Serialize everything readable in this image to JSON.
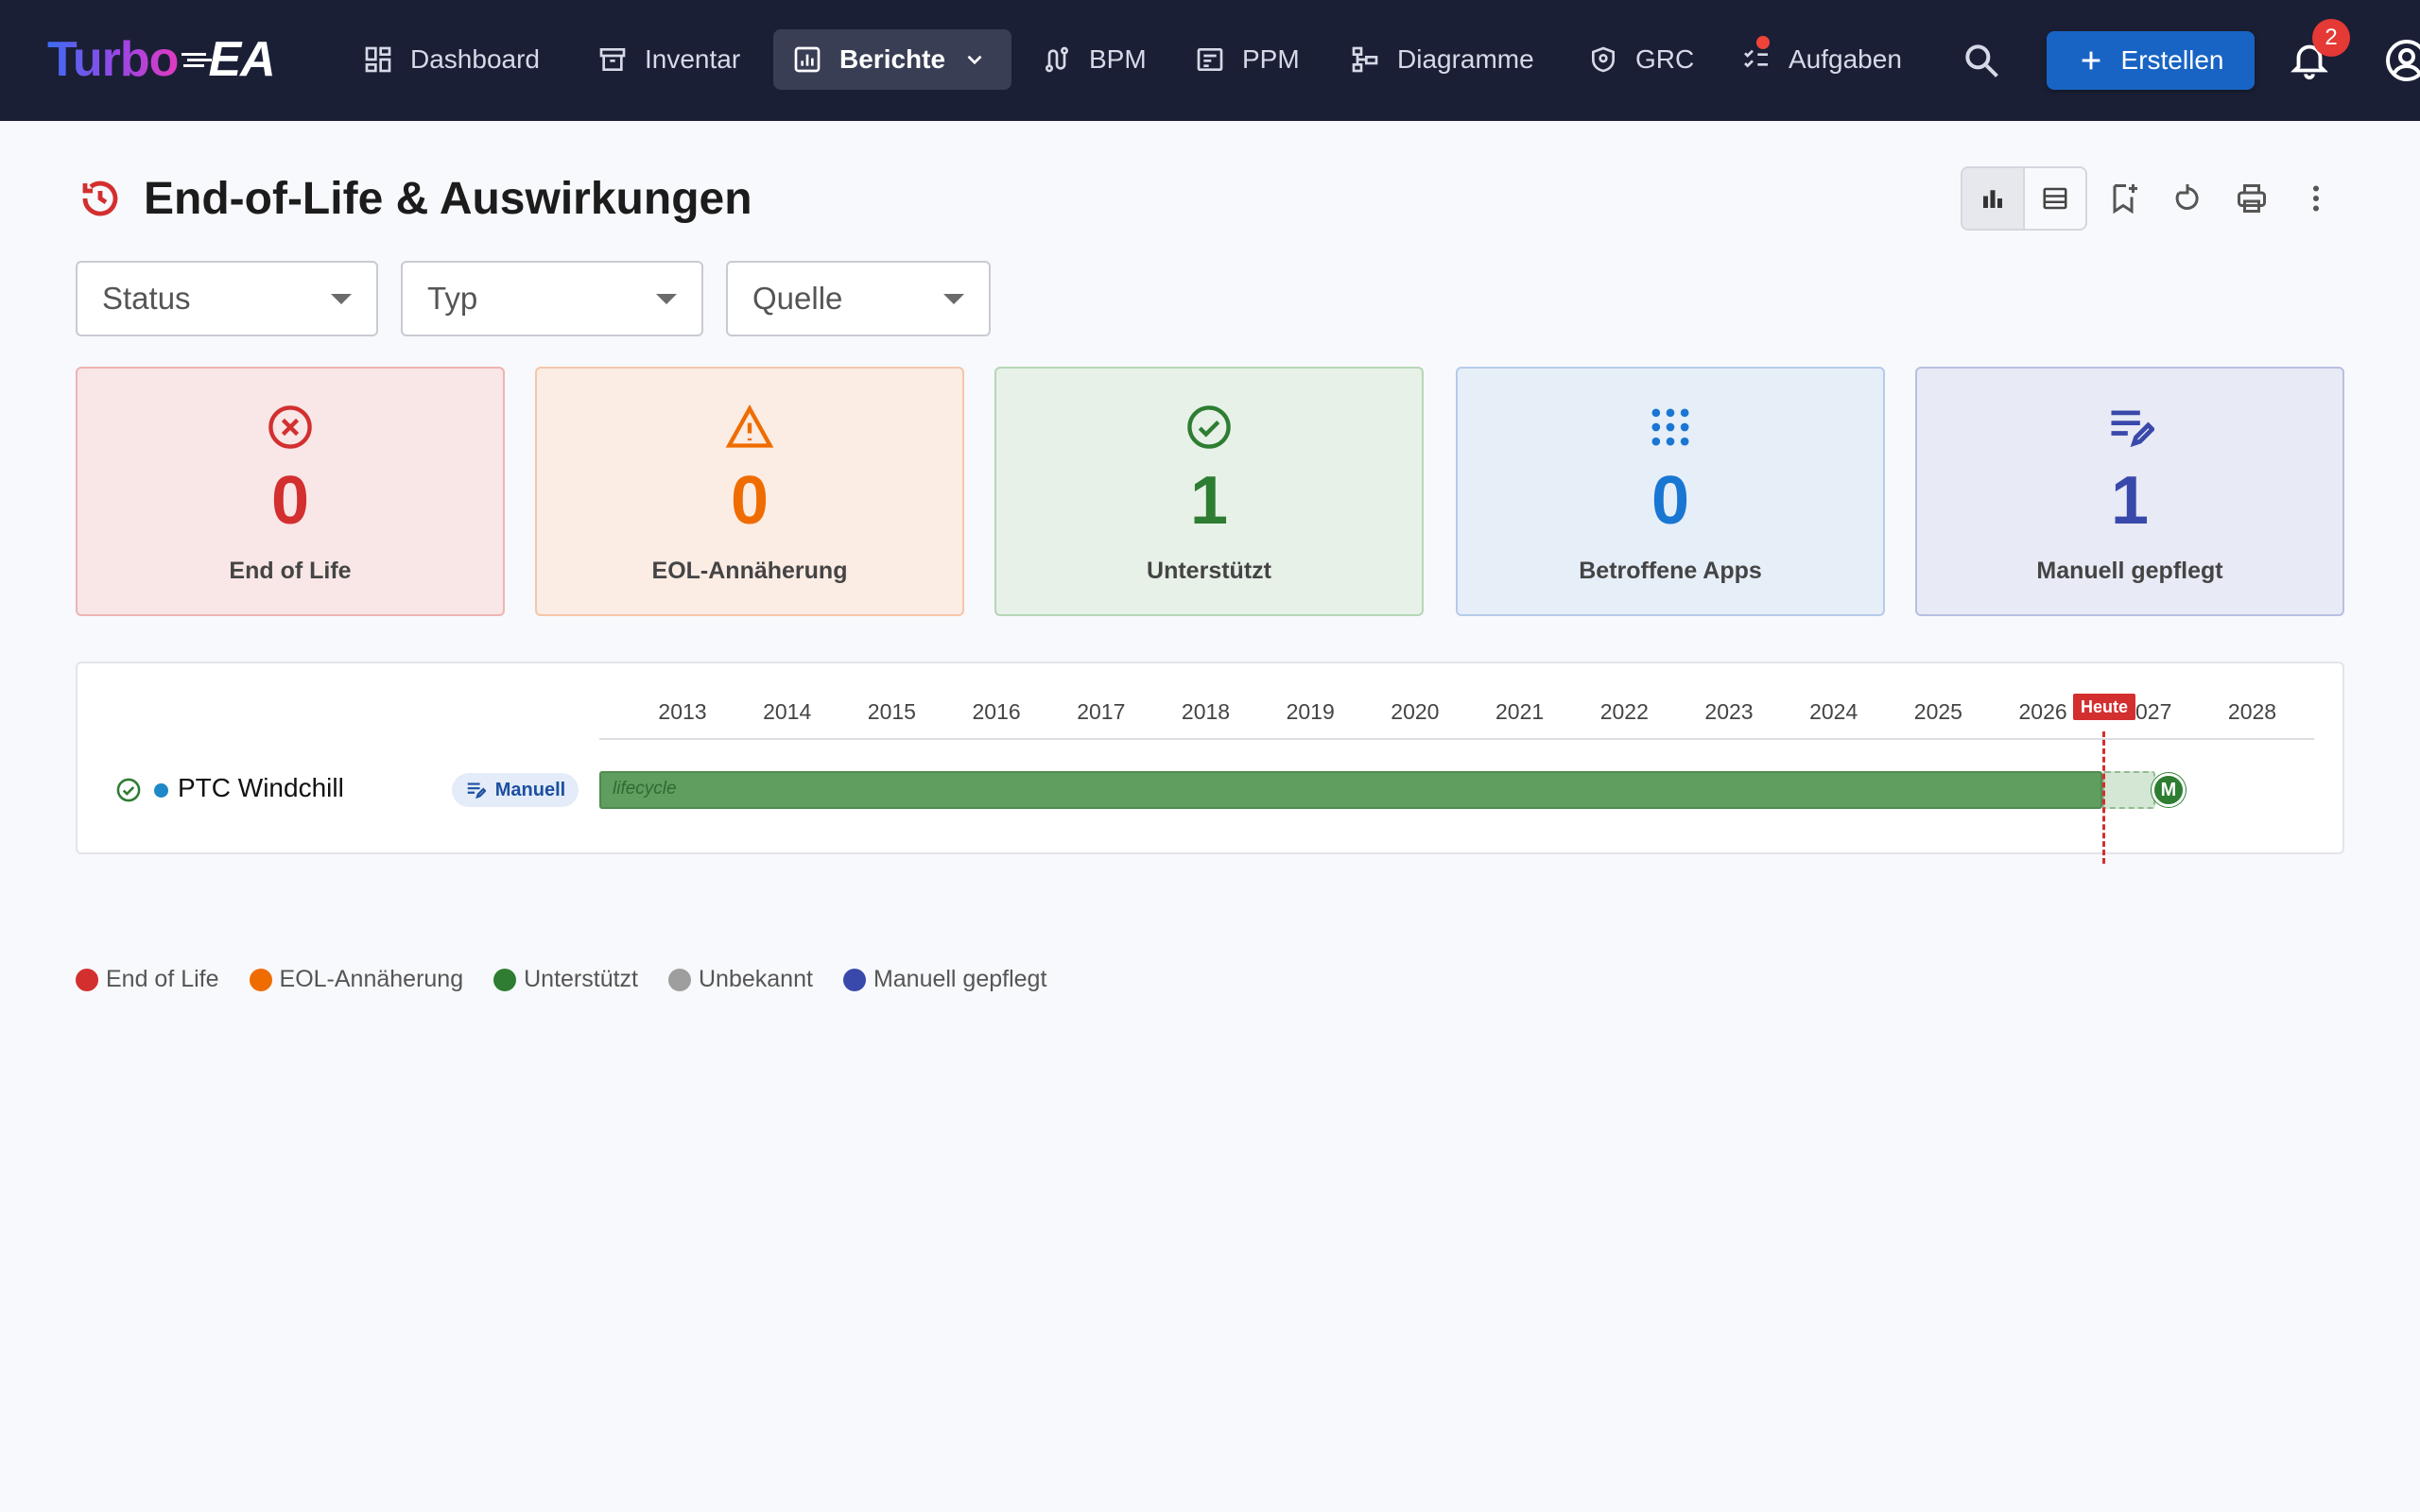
{
  "app": {
    "logo_turbo": "Turbo",
    "logo_ea": "EA"
  },
  "nav": {
    "dashboard": "Dashboard",
    "inventar": "Inventar",
    "berichte": "Berichte",
    "bpm": "BPM",
    "ppm": "PPM",
    "diagramme": "Diagramme",
    "grc": "GRC",
    "aufgaben": "Aufgaben",
    "create_label": "Erstellen",
    "notification_count": "2"
  },
  "page": {
    "title": "End-of-Life & Auswirkungen"
  },
  "filters": {
    "status": "Status",
    "typ": "Typ",
    "quelle": "Quelle"
  },
  "stats": [
    {
      "value": "0",
      "label": "End of Life",
      "color": "#d32f2f"
    },
    {
      "value": "0",
      "label": "EOL-Annäherung",
      "color": "#ef6c00"
    },
    {
      "value": "1",
      "label": "Unterstützt",
      "color": "#2e7d32"
    },
    {
      "value": "0",
      "label": "Betroffene Apps",
      "color": "#1976d2"
    },
    {
      "value": "1",
      "label": "Manuell gepflegt",
      "color": "#3949ab"
    }
  ],
  "timeline": {
    "years": [
      "2013",
      "2014",
      "2015",
      "2016",
      "2017",
      "2018",
      "2019",
      "2020",
      "2021",
      "2022",
      "2023",
      "2024",
      "2025",
      "2026",
      "2027",
      "2028"
    ],
    "today_label": "Heute",
    "row": {
      "name": "PTC Windchill",
      "source_chip": "Manuell",
      "bar_label": "lifecycle",
      "milestone": "M"
    }
  },
  "legend": [
    {
      "label": "End of Life",
      "color": "#d32f2f"
    },
    {
      "label": "EOL-Annäherung",
      "color": "#ef6c00"
    },
    {
      "label": "Unterstützt",
      "color": "#2e7d32"
    },
    {
      "label": "Unbekannt",
      "color": "#9e9e9e"
    },
    {
      "label": "Manuell gepflegt",
      "color": "#3949ab"
    }
  ]
}
